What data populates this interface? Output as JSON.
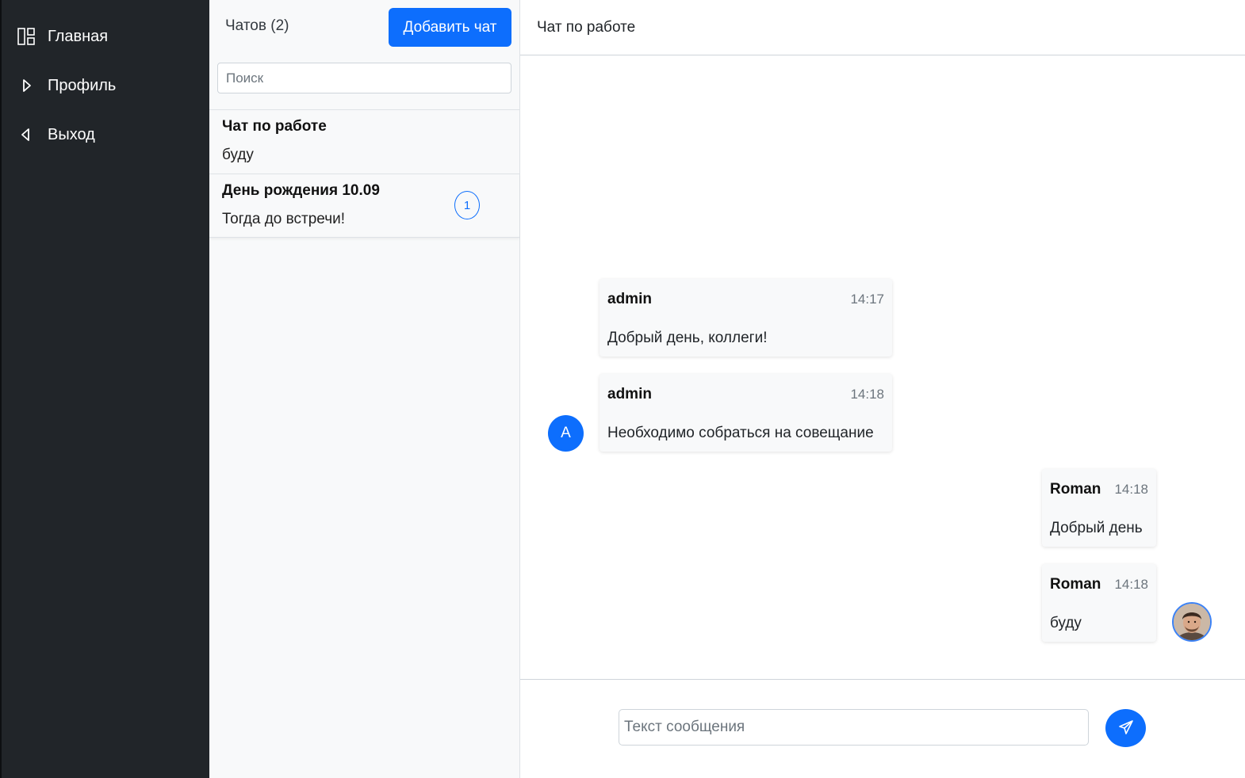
{
  "sidebar": {
    "items": [
      {
        "label": "Главная",
        "icon": "layout-icon"
      },
      {
        "label": "Профиль",
        "icon": "caret-right-icon"
      },
      {
        "label": "Выход",
        "icon": "caret-left-icon"
      }
    ]
  },
  "chat_list": {
    "count_label": "Чатов (2)",
    "add_button": "Добавить чат",
    "search_placeholder": "Поиск",
    "chats": [
      {
        "title": "Чат по работе",
        "preview": "буду"
      },
      {
        "title": "День рождения 10.09",
        "preview": "Тогда до встречи!",
        "unread": "1"
      }
    ]
  },
  "conversation": {
    "title": "Чат по работе",
    "messages": [
      {
        "author": "admin",
        "time": "14:17",
        "text": "Добрый день, коллеги!"
      },
      {
        "author": "admin",
        "time": "14:18",
        "text": "Необходимо собраться на совещание"
      },
      {
        "author": "Roman",
        "time": "14:18",
        "text": "Добрый день"
      },
      {
        "author": "Roman",
        "time": "14:18",
        "text": "буду"
      }
    ],
    "avatar_letter": "A",
    "composer": {
      "placeholder": "Текст сообщения"
    }
  },
  "colors": {
    "accent": "#0d6efd",
    "sidebar_bg": "#212529",
    "panel_bg": "#f8f9fa"
  }
}
